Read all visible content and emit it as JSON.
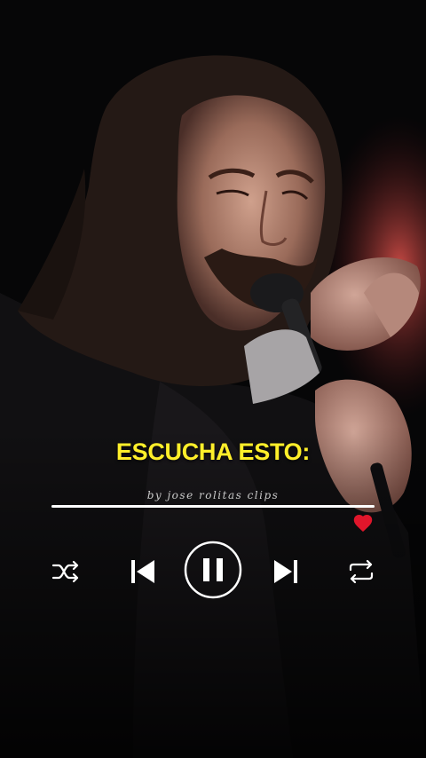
{
  "overlay": {
    "caption": "ESCUCHA ESTO:",
    "credit": "by jose rolitas clips"
  },
  "player": {
    "progress_fraction": 1.0,
    "liked": true,
    "playing": true,
    "controls": [
      "shuffle-icon",
      "previous-icon",
      "pause-icon",
      "next-icon",
      "repeat-icon"
    ]
  },
  "colors": {
    "caption": "#ffef2a",
    "heart": "#e0162b",
    "controls": "#ffffff",
    "background": "#050506"
  }
}
